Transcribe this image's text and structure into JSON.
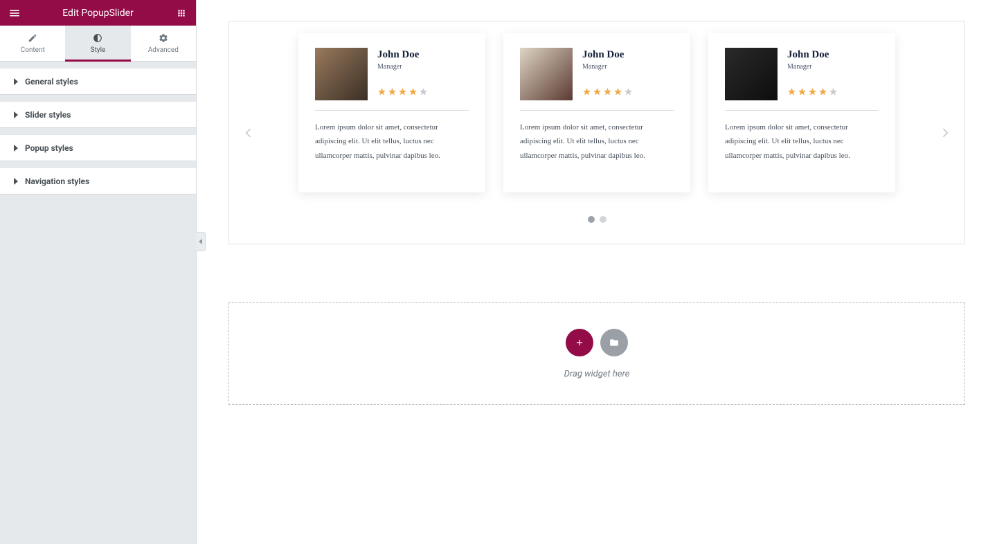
{
  "header": {
    "title": "Edit PopupSlider"
  },
  "tabs": {
    "content": "Content",
    "style": "Style",
    "advanced": "Advanced"
  },
  "sections": [
    "General styles",
    "Slider styles",
    "Popup styles",
    "Navigation styles"
  ],
  "cards": [
    {
      "name": "John Doe",
      "role": "Manager",
      "rating": 4,
      "text": "Lorem ipsum dolor sit amet, consectetur adipiscing elit. Ut elit tellus, luctus nec ullamcorper mattis, pulvinar dapibus leo."
    },
    {
      "name": "John Doe",
      "role": "Manager",
      "rating": 4,
      "text": "Lorem ipsum dolor sit amet, consectetur adipiscing elit. Ut elit tellus, luctus nec ullamcorper mattis, pulvinar dapibus leo."
    },
    {
      "name": "John Doe",
      "role": "Manager",
      "rating": 4,
      "text": "Lorem ipsum dolor sit amet, consectetur adipiscing elit. Ut elit tellus, luctus nec ullamcorper mattis, pulvinar dapibus leo."
    }
  ],
  "dropzone": {
    "label": "Drag widget here"
  }
}
